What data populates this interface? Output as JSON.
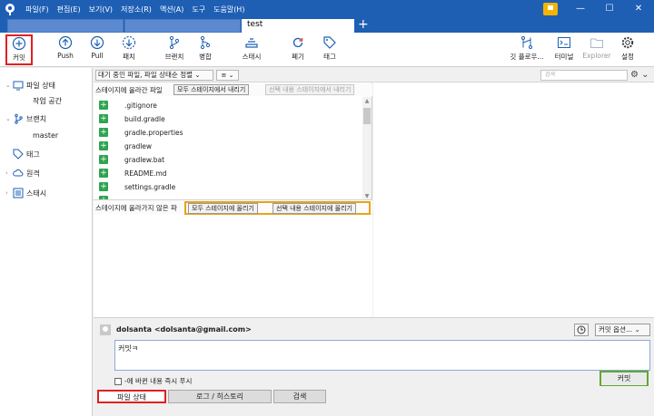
{
  "menubar": [
    "파일(F)",
    "편집(E)",
    "보기(V)",
    "저장소(R)",
    "액션(A)",
    "도구",
    "도움말(H)"
  ],
  "tabs": {
    "active_label": "test",
    "add_label": "+"
  },
  "toolbar": {
    "commit": "커밋",
    "push": "Push",
    "pull": "Pull",
    "fetch": "패치",
    "branch": "브랜치",
    "merge": "병합",
    "stash": "스태시",
    "discard": "폐기",
    "tag": "태그",
    "git_flow": "깃 플로우...",
    "terminal": "터미널",
    "explorer": "Explorer",
    "settings": "설정"
  },
  "sidebar": {
    "file_status": "파일 상태",
    "working_copy": "작업 공간",
    "branches": "브랜치",
    "master": "master",
    "tags": "태그",
    "remotes": "원격",
    "stashes": "스태시"
  },
  "center": {
    "filter": "대기 중인 파일, 파일 상태순 정렬",
    "view": "≡",
    "staged_title": "스테이지에 올라간 파일",
    "unstage_all": "모두 스테이지에서 내리기",
    "unstage_selected": "선택 내용 스테이지에서 내리기",
    "unstaged_title": "스테이지에 올라가지 않은 파",
    "stage_all": "모두 스테이지에 올리기",
    "stage_selected": "선택 내용 스테이지에 올리기",
    "files": [
      ".gitignore",
      "build.gradle",
      "gradle.properties",
      "gradlew",
      "gradlew.bat",
      "README.md",
      "settings.gradle"
    ]
  },
  "right": {
    "search_placeholder": "검색"
  },
  "commit": {
    "author": "dolsanta <dolsanta@gmail.com>",
    "options": "커밋 옵션...",
    "message": "커밋ㅋ",
    "push_immediately": "-에 바뀐 내용 즉시 푸시",
    "submit": "커밋"
  },
  "bottom_tabs": [
    "파일 상태",
    "로그 / 히스토리",
    "검색"
  ],
  "colors": {
    "titlebar": "#1e5fb4",
    "highlight_red": "#e02020",
    "highlight_orange": "#e8a317",
    "highlight_green": "#5fa832",
    "add_green": "#2ea44f"
  }
}
